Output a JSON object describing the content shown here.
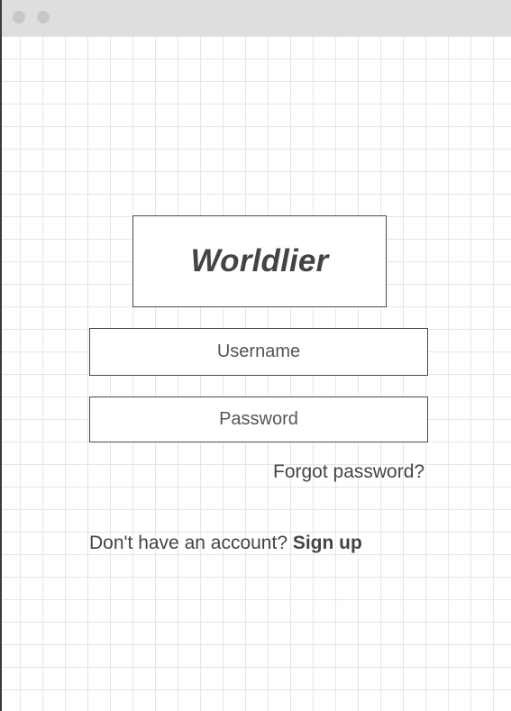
{
  "window": {
    "controls": [
      "close",
      "minimize"
    ]
  },
  "app": {
    "logo_text": "Worldlier"
  },
  "login": {
    "username_placeholder": "Username",
    "password_placeholder": "Password",
    "forgot_password_label": "Forgot password?",
    "signup_prompt": "Don't have an account?",
    "signup_link_label": "Sign up"
  },
  "colors": {
    "grid_line": "#e6e6e6",
    "titlebar": "#dedede",
    "window_button": "#c8c8c8",
    "border": "#4a4a4a",
    "text": "#444444"
  }
}
